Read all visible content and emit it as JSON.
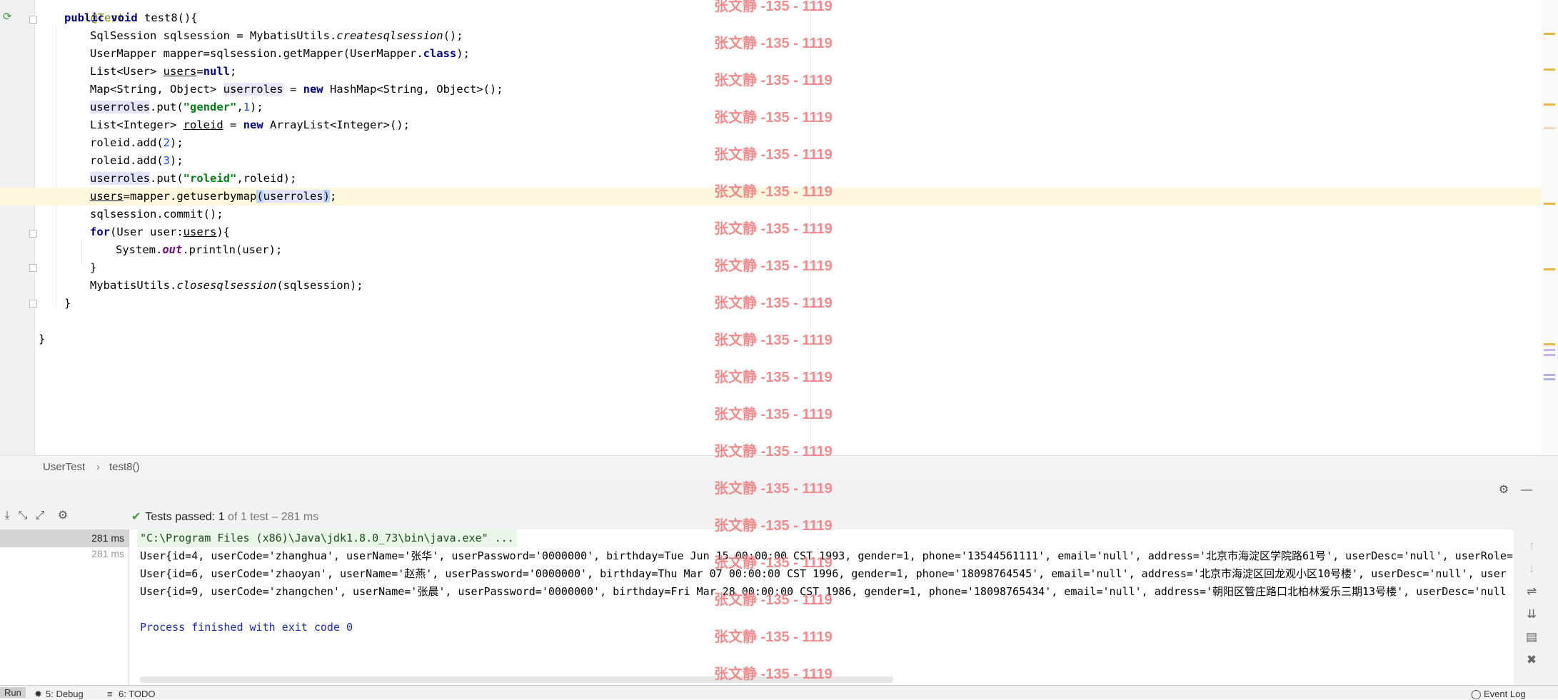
{
  "editor": {
    "annotation": "@Test",
    "method_sig_kw": "public void",
    "method_sig_name": " test8(){",
    "l1_a": "SqlSession sqlsession = MybatisUtils.",
    "l1_b": "createsqlsession",
    "l1_c": "();",
    "l2_a": "UserMapper mapper=sqlsession.getMapper(UserMapper.",
    "l2_b": "class",
    "l2_c": ");",
    "l3_a": "List<User> ",
    "l3_b": "users",
    "l3_c": "=",
    "l3_d": "null",
    "l3_e": ";",
    "l4_a": "Map<String, Object> ",
    "l4_b": "userroles",
    "l4_c": " = ",
    "l4_d": "new",
    "l4_e": " HashMap<String, Object>();",
    "l5_a": "userroles",
    "l5_b": ".put(",
    "l5_c": "\"gender\"",
    "l5_d": ",",
    "l5_e": "1",
    "l5_f": ");",
    "l6_a": "List<Integer> ",
    "l6_b": "roleid",
    "l6_c": " = ",
    "l6_d": "new",
    "l6_e": " ArrayList<Integer>();",
    "l7_a": "roleid.add(",
    "l7_b": "2",
    "l7_c": ");",
    "l8_a": "roleid.add(",
    "l8_b": "3",
    "l8_c": ");",
    "l9_a": "userroles",
    "l9_b": ".put(",
    "l9_c": "\"roleid\"",
    "l9_d": ",roleid);",
    "l10_a": "users",
    "l10_b": "=mapper.getuserbymap",
    "l10_c": "(",
    "l10_d": "userroles",
    "l10_e": ")",
    "l10_f": ";",
    "l11": "sqlsession.commit();",
    "l12_a": "for",
    "l12_b": "(User user:",
    "l12_c": "users",
    "l12_d": "){",
    "l13_a": "System.",
    "l13_b": "out",
    "l13_c": ".println(user);",
    "l14": "}",
    "l15_a": "MybatisUtils.",
    "l15_b": "closesqlsession",
    "l15_c": "(sqlsession);",
    "l16": "}",
    "l17": "}"
  },
  "breadcrumb": {
    "class_name": "UserTest",
    "separator": "›",
    "method_name": "test8()"
  },
  "run_panel": {
    "tests_passed_label": "Tests passed:",
    "tests_passed_count": "1",
    "tests_passed_detail": "of 1 test – 281 ms",
    "tree": [
      {
        "time": "281 ms"
      },
      {
        "time": "281 ms"
      }
    ],
    "console": {
      "command": "\"C:\\Program Files (x86)\\Java\\jdk1.8.0_73\\bin\\java.exe\" ...",
      "lines": [
        "User{id=4, userCode='zhanghua', userName='张华', userPassword='0000000', birthday=Tue Jun 15 00:00:00 CST 1993, gender=1, phone='13544561111', email='null', address='北京市海淀区学院路61号', userDesc='null', userRole=",
        "User{id=6, userCode='zhaoyan', userName='赵燕', userPassword='0000000', birthday=Thu Mar 07 00:00:00 CST 1996, gender=1, phone='18098764545', email='null', address='北京市海淀区回龙观小区10号楼', userDesc='null', user",
        "User{id=9, userCode='zhangchen', userName='张晨', userPassword='0000000', birthday=Fri Mar 28 00:00:00 CST 1986, gender=1, phone='18098765434', email='null', address='朝阳区管庄路口北柏林爱乐三期13号楼', userDesc='null"
      ],
      "exit": "Process finished with exit code 0"
    }
  },
  "bottom_bar": {
    "run_tab": "Run",
    "debug_tab": "5: Debug",
    "todo_tab": "6: TODO",
    "event_log": "Event Log"
  },
  "watermark": "张文静 -135 - 1119",
  "colors": {
    "keyword": "#000080",
    "string": "#067d17",
    "number": "#1750eb",
    "success": "#3e9c3e",
    "watermark": "#f08080"
  },
  "icons": [
    "run-test-icon",
    "lightbulb-icon",
    "settings-gear-icon",
    "minimize-icon",
    "sort-icon",
    "expand-icon",
    "gear-icon",
    "scroll-up-icon",
    "scroll-down-icon",
    "soft-wrap-icon",
    "scroll-to-end-icon",
    "print-icon",
    "trash-icon"
  ]
}
